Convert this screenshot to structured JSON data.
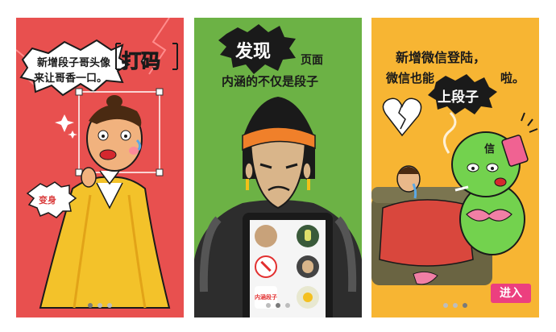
{
  "panels": [
    {
      "id": "intro-1",
      "bg": "#e8504f",
      "headline_line1": "新增段子哥头像",
      "headline_line2": "来让哥香一口。",
      "highlight": "打码",
      "badge": "变身",
      "dots": [
        true,
        false,
        false
      ]
    },
    {
      "id": "intro-2",
      "bg": "#6cb245",
      "highlight": "发现",
      "headline_suffix": "页面",
      "headline_line2": "内涵的不仅是段子",
      "avatar_label": "内涵段子",
      "dots": [
        false,
        true,
        false
      ]
    },
    {
      "id": "intro-3",
      "bg": "#f7b533",
      "headline_line1": "新增微信登陆，",
      "headline_prefix": "微信也能",
      "highlight": "上段子",
      "headline_suffix": "啦。",
      "character_label": "信",
      "enter_label": "进入",
      "dots": [
        false,
        false,
        true
      ]
    }
  ],
  "colors": {
    "red": "#e8504f",
    "green": "#6cb245",
    "yellow": "#f7b533",
    "pink_button": "#ec3f7f"
  }
}
